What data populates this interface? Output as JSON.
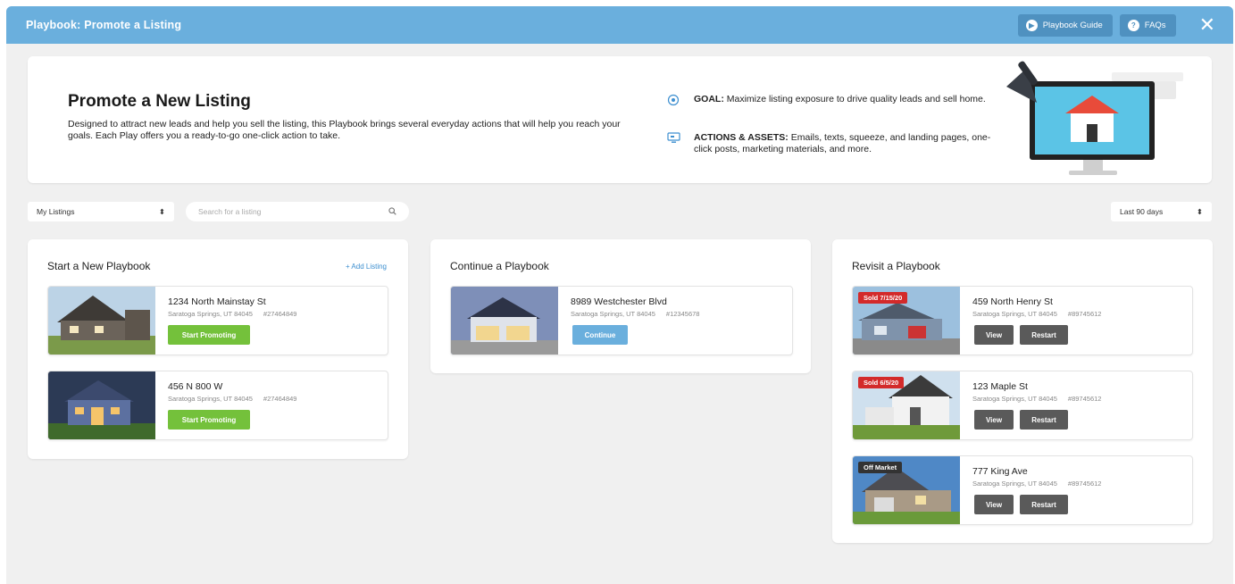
{
  "window": {
    "title": "Playbook:  Promote a Listing",
    "guide_label": "Playbook Guide",
    "faq_label": "FAQs",
    "close_glyph": "✕"
  },
  "hero": {
    "heading": "Promote a New Listing",
    "description": "Designed to attract new leads and help you sell the listing, this Playbook brings several everyday actions that will help you reach your goals. Each Play offers you a ready-to-go one-click action to take.",
    "goal_label": "GOAL:",
    "goal_text": " Maximize listing exposure to drive quality leads and sell home.",
    "actions_label": "ACTIONS & ASSETS:",
    "actions_text": " Emails, texts, squeeze, and landing pages, one-click posts, marketing materials, and more."
  },
  "filters": {
    "listings_select": "My Listings",
    "search_placeholder": "Search for a listing",
    "range_select": "Last 90 days"
  },
  "start": {
    "title": "Start a New Playbook",
    "add_label": "+ Add Listing",
    "cards": [
      {
        "address": "1234 North Mainstay St",
        "city": "Saratoga Springs, UT 84045",
        "mls": "#27464849",
        "button": "Start Promoting"
      },
      {
        "address": "456 N 800 W",
        "city": "Saratoga Springs, UT 84045",
        "mls": "#27464849",
        "button": "Start Promoting"
      }
    ]
  },
  "continue": {
    "title": "Continue a Playbook",
    "cards": [
      {
        "address": "8989 Westchester Blvd",
        "city": "Saratoga Springs, UT 84045",
        "mls": "#12345678",
        "button": "Continue"
      }
    ]
  },
  "revisit": {
    "title": "Revisit a Playbook",
    "cards": [
      {
        "badge": "Sold 7/15/20",
        "address": "459 North Henry St",
        "city": "Saratoga Springs, UT 84045",
        "mls": "#89745612",
        "view": "View",
        "restart": "Restart"
      },
      {
        "badge": "Sold 6/5/20",
        "address": "123 Maple St",
        "city": "Saratoga Springs, UT 84045",
        "mls": "#89745612",
        "view": "View",
        "restart": "Restart"
      },
      {
        "badge": "Off Market",
        "address": "777 King Ave",
        "city": "Saratoga Springs, UT 84045",
        "mls": "#89745612",
        "view": "View",
        "restart": "Restart"
      }
    ]
  },
  "colors": {
    "titlebar": "#6aafdd",
    "accent_green": "#74c13b",
    "accent_blue": "#6aafdd",
    "sold_red": "#d32a2a"
  }
}
